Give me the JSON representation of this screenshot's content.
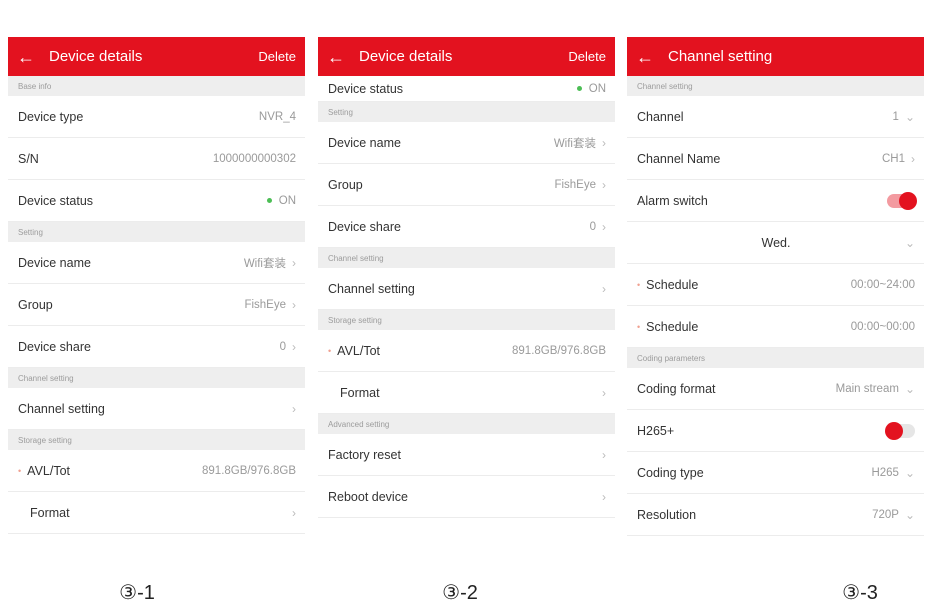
{
  "screens": [
    {
      "title": "Device details",
      "action": "Delete",
      "rows": [
        {
          "type": "section",
          "label": "Base info"
        },
        {
          "type": "row",
          "label": "Device type",
          "value": "NVR_4"
        },
        {
          "type": "row",
          "label": "S/N",
          "value": "1000000000302"
        },
        {
          "type": "row",
          "label": "Device status",
          "value": "ON",
          "status_dot": true
        },
        {
          "type": "section",
          "label": "Setting"
        },
        {
          "type": "row",
          "label": "Device name",
          "value": "Wifi套装",
          "chevron": true
        },
        {
          "type": "row",
          "label": "Group",
          "value": "FishEye",
          "chevron": true
        },
        {
          "type": "row",
          "label": "Device share",
          "value": "0",
          "chevron": true
        },
        {
          "type": "section",
          "label": "Channel setting"
        },
        {
          "type": "row",
          "label": "Channel setting",
          "value": "",
          "chevron": true
        },
        {
          "type": "section",
          "label": "Storage setting"
        },
        {
          "type": "row",
          "label": "AVL/Tot",
          "value": "891.8GB/976.8GB",
          "bullet": true
        },
        {
          "type": "row",
          "label": "Format",
          "value": "",
          "chevron": true,
          "indent": true
        }
      ]
    },
    {
      "title": "Device details",
      "action": "Delete",
      "rows": [
        {
          "type": "row",
          "label": "Device status",
          "value": "ON",
          "status_dot": true,
          "short": true
        },
        {
          "type": "section",
          "label": "Setting"
        },
        {
          "type": "row",
          "label": "Device name",
          "value": "Wifi套装",
          "chevron": true
        },
        {
          "type": "row",
          "label": "Group",
          "value": "FishEye",
          "chevron": true
        },
        {
          "type": "row",
          "label": "Device share",
          "value": "0",
          "chevron": true
        },
        {
          "type": "section",
          "label": "Channel setting"
        },
        {
          "type": "row",
          "label": "Channel setting",
          "value": "",
          "chevron": true
        },
        {
          "type": "section",
          "label": "Storage setting"
        },
        {
          "type": "row",
          "label": "AVL/Tot",
          "value": "891.8GB/976.8GB",
          "bullet": true
        },
        {
          "type": "row",
          "label": "Format",
          "value": "",
          "chevron": true,
          "indent": true
        },
        {
          "type": "section",
          "label": "Advanced setting"
        },
        {
          "type": "row",
          "label": "Factory reset",
          "value": "",
          "chevron": true
        },
        {
          "type": "row",
          "label": "Reboot device",
          "value": "",
          "chevron": true
        }
      ]
    },
    {
      "title": "Channel setting",
      "action": "",
      "rows": [
        {
          "type": "section",
          "label": "Channel setting"
        },
        {
          "type": "row",
          "label": "Channel",
          "value": "1",
          "dropdown": true
        },
        {
          "type": "row",
          "label": "Channel Name",
          "value": "CH1",
          "chevron": true
        },
        {
          "type": "row",
          "label": "Alarm switch",
          "toggle": "on"
        },
        {
          "type": "center",
          "label": "Wed.",
          "dropdown": true
        },
        {
          "type": "row",
          "label": "Schedule",
          "value": "00:00~24:00",
          "bullet": true
        },
        {
          "type": "row",
          "label": "Schedule",
          "value": "00:00~00:00",
          "bullet": true
        },
        {
          "type": "section",
          "label": "Coding parameters"
        },
        {
          "type": "row",
          "label": "Coding format",
          "value": "Main stream",
          "dropdown": true
        },
        {
          "type": "row",
          "label": "H265+",
          "toggle": "off"
        },
        {
          "type": "row",
          "label": "Coding type",
          "value": "H265",
          "dropdown": true
        },
        {
          "type": "row",
          "label": "Resolution",
          "value": "720P",
          "dropdown": true
        }
      ]
    }
  ],
  "captions": [
    "③-1",
    "③-2",
    "③-3"
  ],
  "icons": {
    "back": "arrow-left-icon",
    "chevron": "chevron-right-icon",
    "dropdown": "chevron-down-icon"
  },
  "colors": {
    "accent": "#e3121f",
    "status_on": "#4cbe55"
  }
}
